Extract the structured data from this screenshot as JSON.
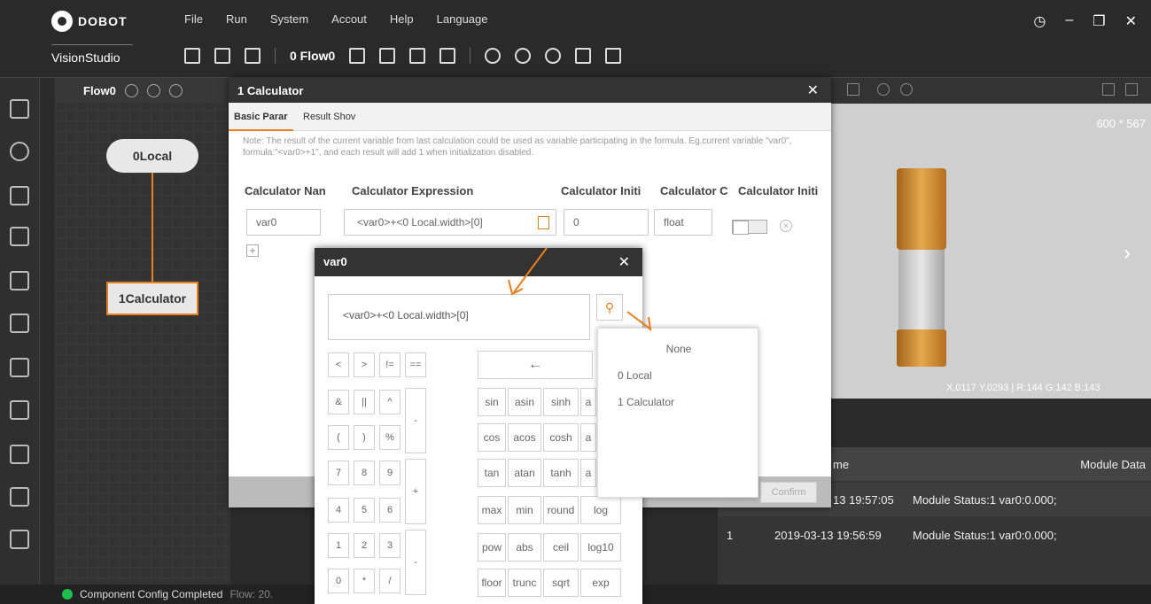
{
  "app": {
    "brand": "DOBOT",
    "name": "VisionStudio"
  },
  "menu": [
    "File",
    "Run",
    "System",
    "Accout",
    "Help",
    "Language"
  ],
  "toolbar": {
    "flow_select": "0 Flow0"
  },
  "flow_panel": {
    "title": "Flow0",
    "nodes": [
      "0Local",
      "1Calculator"
    ]
  },
  "image_panel": {
    "size": "600 * 567",
    "coords": "X,0117  Y,0293  |  R:144  G:142  B:143"
  },
  "result_table": {
    "headers": [
      "me",
      "Module Data"
    ],
    "rows": [
      {
        "index": "",
        "time": "13 19:57:05",
        "data": "Module Status:1 var0:0.000;"
      },
      {
        "index": "1",
        "time": "2019-03-13 19:56:59",
        "data": "Module Status:1 var0:0.000;"
      }
    ]
  },
  "status_bar": {
    "text": "Component Config Completed",
    "flow": "Flow: 20."
  },
  "calculator_dialog": {
    "title": "1 Calculator",
    "tabs": [
      "Basic Parar",
      "Result Shov"
    ],
    "note": "Note: The result of the current variable from last calculation could be used as variable participating in the formula. Eg.current variable \"var0\", formula:\"<var0>+1\", and each result will add 1 when initialization disabled.",
    "columns": [
      "Calculator Nan",
      "Calculator Expression",
      "Calculator Initi",
      "Calculator C",
      "Calculator Initi"
    ],
    "row": {
      "name": "var0",
      "expression": "<var0>+<0 Local.width>[0]",
      "init": "0",
      "type": "float"
    },
    "confirm": "Confirm"
  },
  "var_dialog": {
    "title": "var0",
    "expression": "<var0>+<0 Local.width>[0]",
    "keys": [
      "<",
      ">",
      "!=",
      "==",
      "&",
      "||",
      "^",
      "(",
      ")",
      "%",
      "7",
      "8",
      "9",
      "4",
      "5",
      "6",
      "1",
      "2",
      "3",
      "0",
      "*",
      "/",
      "-",
      "+",
      "-"
    ],
    "backspace": "←",
    "functions": [
      [
        "sin",
        "asin",
        "sinh",
        "a"
      ],
      [
        "cos",
        "acos",
        "cosh",
        "a"
      ],
      [
        "tan",
        "atan",
        "tanh",
        "a"
      ],
      [
        "max",
        "min",
        "round",
        "log"
      ],
      [
        "pow",
        "abs",
        "ceil",
        "log10"
      ],
      [
        "floor",
        "trunc",
        "sqrt",
        "exp"
      ]
    ]
  },
  "variable_dropdown": {
    "items": [
      "None",
      "0 Local",
      "1 Calculator"
    ]
  },
  "colors": {
    "accent": "#e87e1e",
    "status_ok": "#1fbf4d"
  }
}
